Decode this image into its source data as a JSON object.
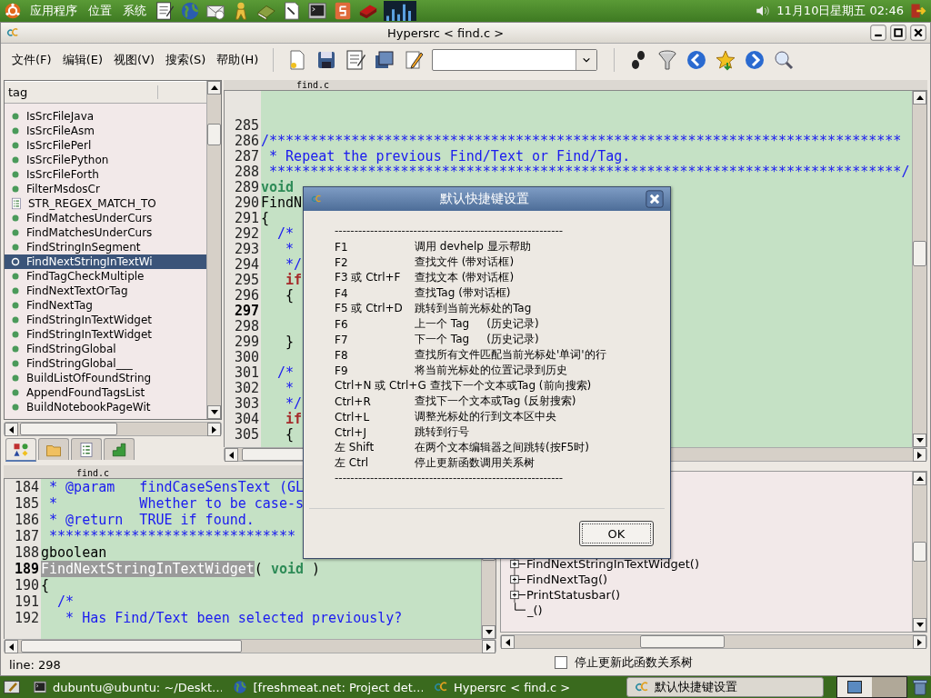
{
  "top_panel": {
    "menus": [
      "应用程序",
      "位置",
      "系统"
    ],
    "clock": "11月10日星期五 02:46"
  },
  "window": {
    "title": "Hypersrc < find.c >"
  },
  "menu_bar": [
    "文件(F)",
    "编辑(E)",
    "视图(V)",
    "搜索(S)",
    "帮助(H)"
  ],
  "tag_list": {
    "header": "tag",
    "items": [
      {
        "name": "IsSrcFileJava",
        "kind": "function",
        "selected": false
      },
      {
        "name": "IsSrcFileAsm",
        "kind": "function",
        "selected": false
      },
      {
        "name": "IsSrcFilePerl",
        "kind": "function",
        "selected": false
      },
      {
        "name": "IsSrcFilePython",
        "kind": "function",
        "selected": false
      },
      {
        "name": "IsSrcFileForth",
        "kind": "function",
        "selected": false
      },
      {
        "name": "FilterMsdosCr",
        "kind": "function",
        "selected": false
      },
      {
        "name": "STR_REGEX_MATCH_TO",
        "kind": "macro",
        "selected": false
      },
      {
        "name": "FindMatchesUnderCurs",
        "kind": "function",
        "selected": false
      },
      {
        "name": "FindMatchesUnderCurs",
        "kind": "function",
        "selected": false
      },
      {
        "name": "FindStringInSegment",
        "kind": "function",
        "selected": false
      },
      {
        "name": "FindNextStringInTextWi",
        "kind": "function",
        "selected": true
      },
      {
        "name": "FindTagCheckMultiple",
        "kind": "function",
        "selected": false
      },
      {
        "name": "FindNextTextOrTag",
        "kind": "function",
        "selected": false
      },
      {
        "name": "FindNextTag",
        "kind": "function",
        "selected": false
      },
      {
        "name": "FindStringInTextWidget",
        "kind": "function",
        "selected": false
      },
      {
        "name": "FindStringInTextWidget",
        "kind": "function",
        "selected": false
      },
      {
        "name": "FindStringGlobal",
        "kind": "function",
        "selected": false
      },
      {
        "name": "FindStringGlobal___",
        "kind": "function",
        "selected": false
      },
      {
        "name": "BuildListOfFoundString",
        "kind": "function",
        "selected": false
      },
      {
        "name": "AppendFoundTagsList",
        "kind": "function",
        "selected": false
      },
      {
        "name": "BuildNotebookPageWit",
        "kind": "function",
        "selected": false
      }
    ],
    "tabs": [
      {
        "selected": true
      },
      {
        "selected": false
      },
      {
        "selected": false
      },
      {
        "selected": false
      }
    ]
  },
  "editor": {
    "tab": "find.c",
    "lines": [
      {
        "num": "285",
        "current": false
      },
      {
        "num": "286",
        "current": false,
        "parts": [
          {
            "text": "/*****************************************************************************",
            "kind": "comment"
          }
        ]
      },
      {
        "num": "287",
        "current": false,
        "parts": [
          {
            "text": " * Repeat the previous Find/Text or Find/Tag.",
            "kind": "comment"
          }
        ]
      },
      {
        "num": "288",
        "current": false,
        "parts": [
          {
            "text": " *****************************************************************************/",
            "kind": "comment"
          }
        ]
      },
      {
        "num": "289",
        "current": false,
        "parts": [
          {
            "text": "void",
            "kind": "type"
          }
        ]
      },
      {
        "num": "290",
        "current": false,
        "parts": [
          {
            "text": "FindN",
            "kind": "plain"
          }
        ]
      },
      {
        "num": "291",
        "current": false,
        "parts": [
          {
            "text": "{",
            "kind": "plain"
          }
        ]
      },
      {
        "num": "292",
        "current": false,
        "parts": [
          {
            "text": "  /*",
            "kind": "comment"
          }
        ]
      },
      {
        "num": "293",
        "current": false,
        "parts": [
          {
            "text": "   *",
            "kind": "comment"
          }
        ]
      },
      {
        "num": "294",
        "current": false,
        "parts": [
          {
            "text": "   */",
            "kind": "comment"
          }
        ]
      },
      {
        "num": "295",
        "current": false,
        "parts": [
          {
            "text": "   if",
            "kind": "keyword"
          }
        ]
      },
      {
        "num": "296",
        "current": false,
        "parts": [
          {
            "text": "   {",
            "kind": "plain"
          }
        ]
      },
      {
        "num": "297",
        "current": true
      },
      {
        "num": "298",
        "current": false
      },
      {
        "num": "299",
        "current": false,
        "parts": [
          {
            "text": "   }",
            "kind": "plain"
          }
        ]
      },
      {
        "num": "300",
        "current": false
      },
      {
        "num": "301",
        "current": false,
        "parts": [
          {
            "text": "  /*",
            "kind": "comment"
          }
        ]
      },
      {
        "num": "302",
        "current": false,
        "parts": [
          {
            "text": "   *",
            "kind": "comment"
          }
        ]
      },
      {
        "num": "303",
        "current": false,
        "parts": [
          {
            "text": "   */",
            "kind": "comment"
          }
        ]
      },
      {
        "num": "304",
        "current": false,
        "parts": [
          {
            "text": "   if",
            "kind": "keyword"
          }
        ]
      },
      {
        "num": "305",
        "current": false,
        "parts": [
          {
            "text": "   {",
            "kind": "plain"
          }
        ]
      }
    ]
  },
  "lower_editor": {
    "tab": "find.c",
    "lines": [
      {
        "num": "184",
        "current": false,
        "parts": [
          {
            "text": " * @param   findCaseSensText (GL",
            "kind": "comment"
          }
        ]
      },
      {
        "num": "185",
        "current": false,
        "parts": [
          {
            "text": " *          Whether to be case-s",
            "kind": "comment"
          }
        ]
      },
      {
        "num": "186",
        "current": false,
        "parts": [
          {
            "text": " * @return  TRUE if found.",
            "kind": "comment"
          }
        ]
      },
      {
        "num": "187",
        "current": false,
        "parts": [
          {
            "text": " ******************************",
            "kind": "comment"
          }
        ]
      },
      {
        "num": "188",
        "current": false,
        "parts": [
          {
            "text": "gboolean",
            "kind": "plain"
          }
        ]
      },
      {
        "num": "189",
        "current": true,
        "parts": [
          {
            "text": "FindNextStringInTextWidget",
            "kind": "match"
          },
          {
            "text": "( ",
            "kind": "plain"
          },
          {
            "text": "void",
            "kind": "type"
          },
          {
            "text": " )",
            "kind": "plain"
          }
        ]
      },
      {
        "num": "190",
        "current": false,
        "parts": [
          {
            "text": "{",
            "kind": "plain"
          }
        ]
      },
      {
        "num": "191",
        "current": false,
        "parts": [
          {
            "text": "  /*",
            "kind": "comment"
          }
        ]
      },
      {
        "num": "192",
        "current": false,
        "parts": [
          {
            "text": "   * Has Find/Text been selected previously?",
            "kind": "comment"
          }
        ]
      }
    ]
  },
  "status_bar": {
    "text": "line: 298"
  },
  "call_tree": {
    "items": [
      {
        "name": "FindNextStringInTextWidget()",
        "expandable": true
      },
      {
        "name": "FindNextTag()",
        "expandable": true
      },
      {
        "name": "PrintStatusbar()",
        "expandable": true
      },
      {
        "name": "_()",
        "expandable": false
      }
    ],
    "stop_update": {
      "label": "停止更新此函数关系树",
      "checked": false
    }
  },
  "dialog": {
    "title": "默认快捷键设置",
    "separator_top": "----------------------------------------------------------",
    "shortcuts": [
      {
        "key": "F1",
        "action": "调用 devhelp 显示帮助"
      },
      {
        "key": "F2",
        "action": "查找文件 (带对话框)"
      },
      {
        "key": "F3 或 Ctrl+F",
        "action": "查找文本 (带对话框)"
      },
      {
        "key": "F4",
        "action": "查找Tag (带对话框)"
      },
      {
        "key": "F5 或 Ctrl+D",
        "action": "跳转到当前光标处的Tag"
      },
      {
        "key": "F6",
        "action": "上一个 Tag     (历史记录)"
      },
      {
        "key": "F7",
        "action": "下一个 Tag     (历史记录)"
      },
      {
        "key": "F8",
        "action": "查找所有文件匹配当前光标处'单词'的行"
      },
      {
        "key": "F9",
        "action": "将当前光标处的位置记录到历史"
      },
      {
        "key": "Ctrl+N 或 Ctrl+G",
        "action": "查找下一个文本或Tag (前向搜索)"
      },
      {
        "key": "Ctrl+R",
        "action": "查找下一个文本或Tag (反射搜索)"
      },
      {
        "key": "Ctrl+L",
        "action": "调整光标处的行到文本区中央"
      },
      {
        "key": "Ctrl+J",
        "action": "跳转到行号"
      },
      {
        "key": "左 Shift",
        "action": "在两个文本编辑器之间跳转(按F5时)"
      },
      {
        "key": "左 Ctrl",
        "action": "停止更新函数调用关系树"
      }
    ],
    "separator_bottom": "----------------------------------------------------------",
    "ok": "OK"
  },
  "taskbar": {
    "items": [
      {
        "label": "dubuntu@ubuntu: ~/Deskt…",
        "kind": "terminal",
        "selected": false
      },
      {
        "label": "[freshmeat.net: Project det…",
        "kind": "browser",
        "selected": false
      },
      {
        "label": "Hypersrc < find.c >",
        "kind": "app",
        "selected": false
      },
      {
        "label": "默认快捷键设置",
        "kind": "app",
        "selected": true
      }
    ]
  }
}
